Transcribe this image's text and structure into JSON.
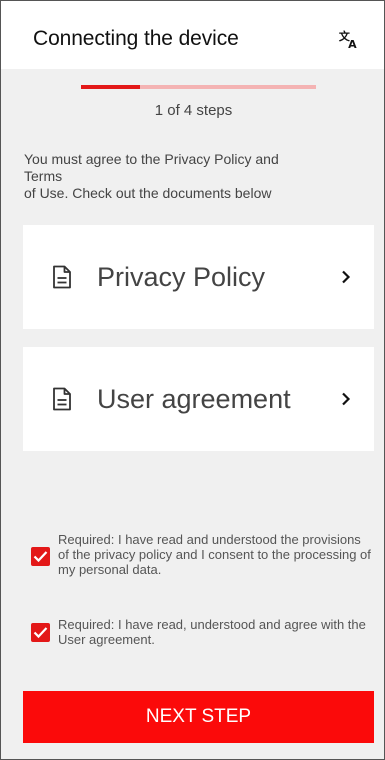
{
  "header": {
    "title": "Connecting the device",
    "translate_icon": "translate-icon"
  },
  "progress": {
    "current_step": 1,
    "total_steps": 4,
    "fraction": 0.25,
    "text": "1  of 4 steps",
    "colors": {
      "filled": "#e31818",
      "track": "#f4b3b3"
    }
  },
  "notice": {
    "line1": "You must agree to the Privacy Policy and",
    "line2": "Terms",
    "line3": "of Use. Check out the documents below"
  },
  "documents": [
    {
      "label": "Privacy Policy",
      "icon": "document-icon",
      "arrow": "chevron-right-icon"
    },
    {
      "label": "User agreement",
      "icon": "document-icon",
      "arrow": "chevron-right-icon"
    }
  ],
  "consents": [
    {
      "checked": true,
      "text": "Required: I have read and understood the provisions of the privacy policy and I consent to the processing of my personal data."
    },
    {
      "checked": true,
      "text": "Required: I have read, understood and agree with the User agreement."
    }
  ],
  "actions": {
    "next_label": "NEXT STEP"
  },
  "colors": {
    "accent": "#fb0a0a",
    "background": "#f0f0f0",
    "card": "#ffffff"
  }
}
